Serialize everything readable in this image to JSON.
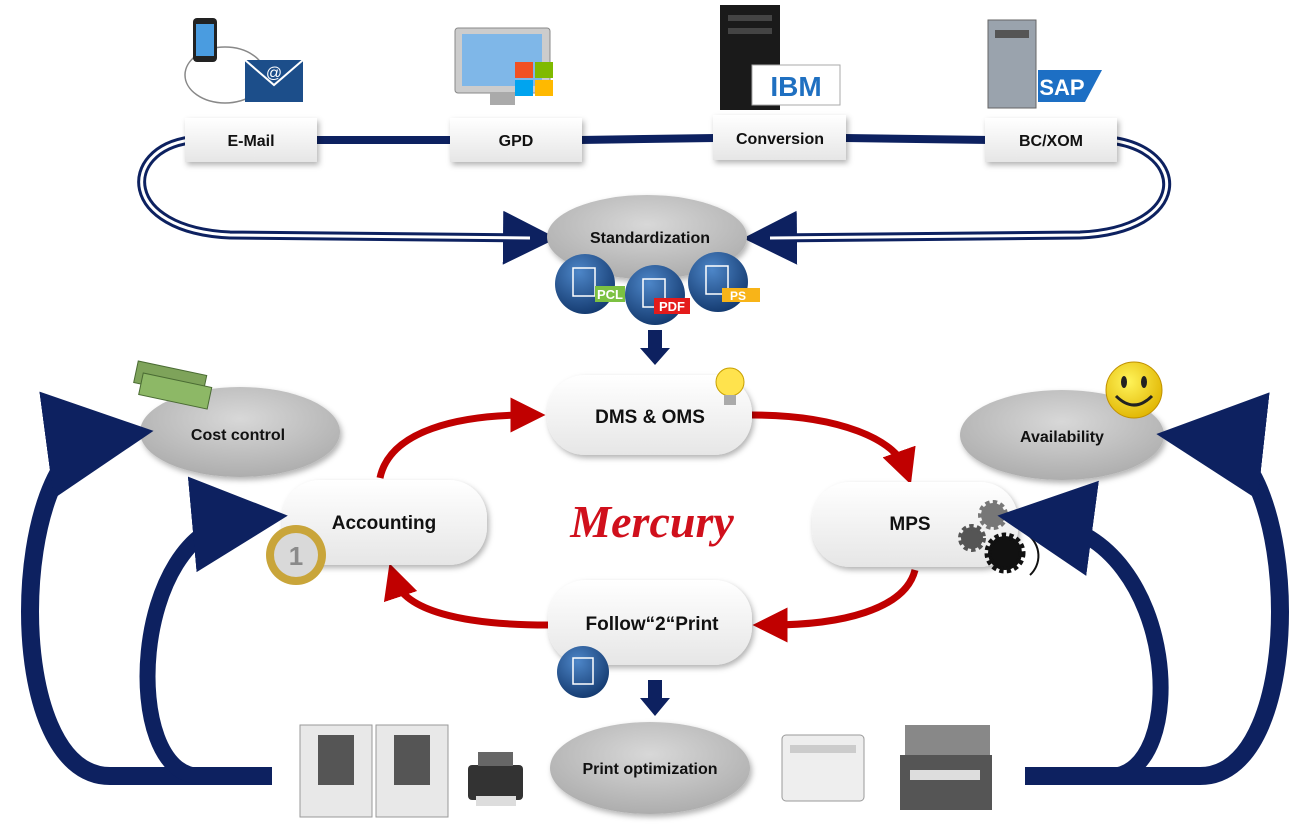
{
  "sources": [
    {
      "label": "E-Mail",
      "icon": "email-cloud-icon"
    },
    {
      "label": "GPD",
      "icon": "windows-pc-icon"
    },
    {
      "label": "Conversion",
      "icon": "ibm-server-icon"
    },
    {
      "label": "BC/XOM",
      "icon": "sap-server-icon"
    }
  ],
  "standardization": {
    "label": "Standardization",
    "formats": [
      "PCL",
      "PDF",
      "PS"
    ]
  },
  "cycle": {
    "dms": "DMS & OMS",
    "mps": "MPS",
    "follow": "Follow“2“Print",
    "accounting": "Accounting"
  },
  "logo": "Mercury",
  "outcomes": {
    "cost_control": "Cost control",
    "availability": "Availability",
    "print_optimization": "Print optimization"
  },
  "colors": {
    "navy": "#0d2160",
    "red": "#c00000",
    "grey_ellipse": "#c8c8c8",
    "pcl": "#7cc142",
    "pdf": "#e41b1b",
    "ps": "#f8b418"
  }
}
